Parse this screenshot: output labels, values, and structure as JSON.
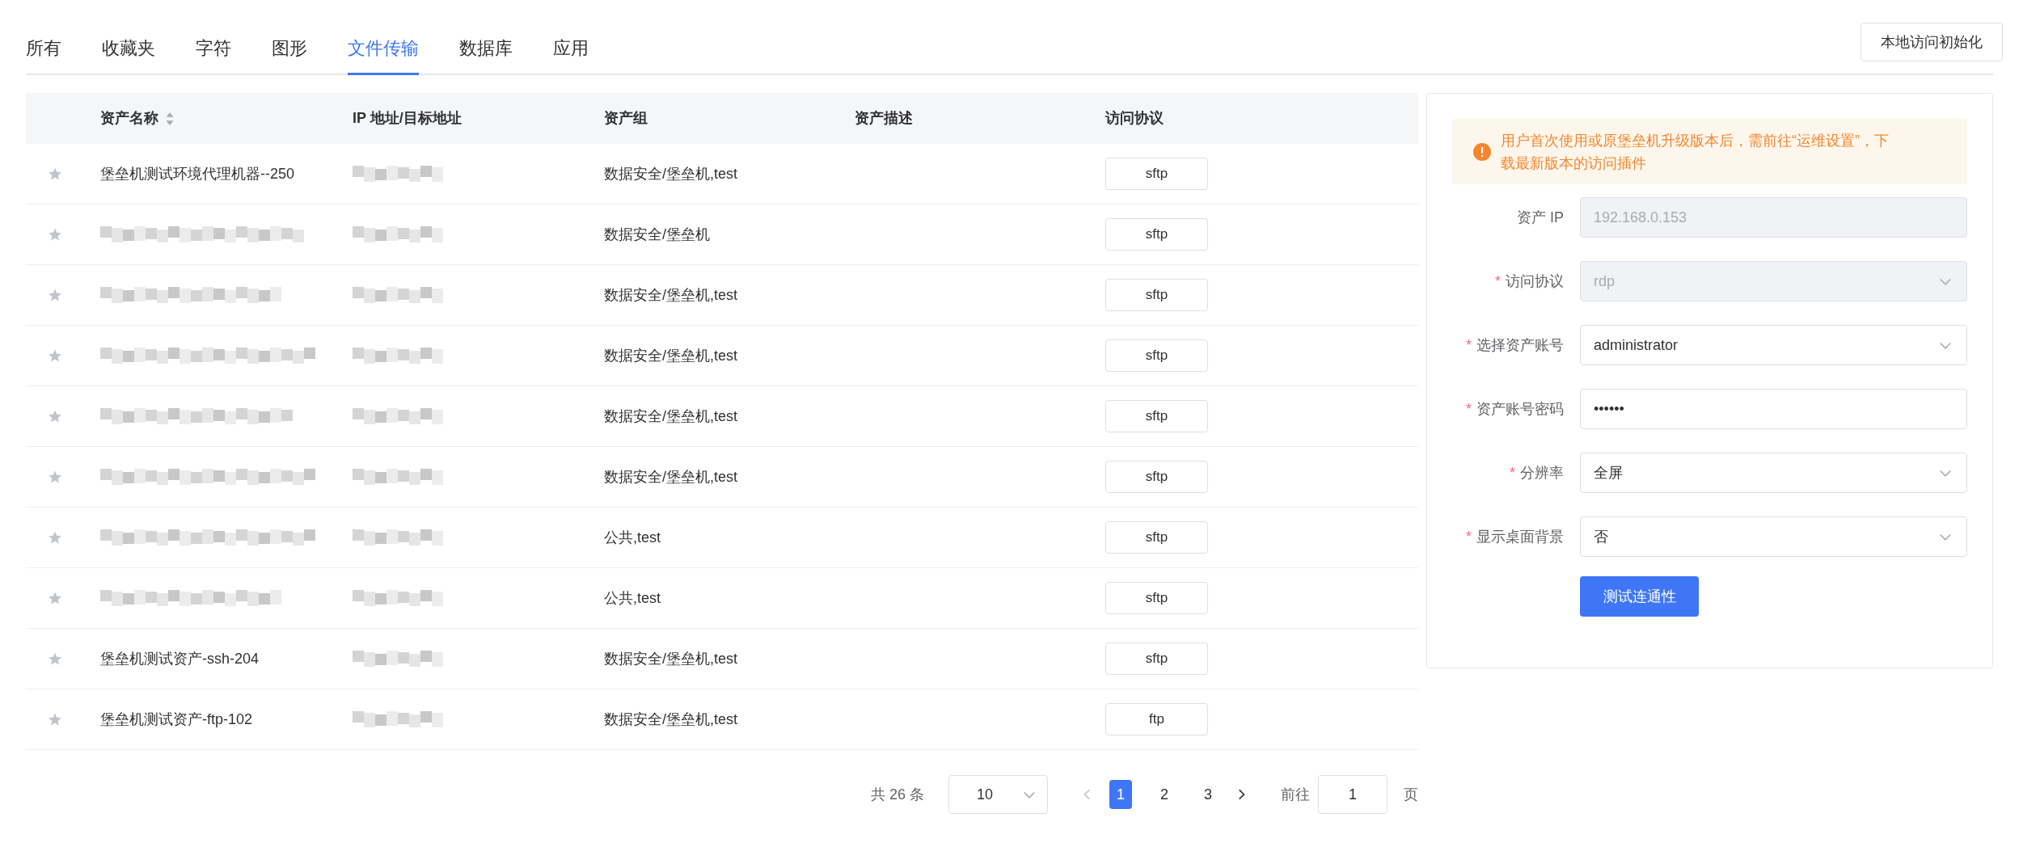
{
  "tabs": [
    {
      "label": "所有",
      "selected": false
    },
    {
      "label": "收藏夹",
      "selected": false
    },
    {
      "label": "字符",
      "selected": false
    },
    {
      "label": "图形",
      "selected": false
    },
    {
      "label": "文件传输",
      "selected": true
    },
    {
      "label": "数据库",
      "selected": false
    },
    {
      "label": "应用",
      "selected": false
    }
  ],
  "init_button": "本地访问初始化",
  "table": {
    "columns": [
      "资产名称",
      "IP 地址/目标地址",
      "资产组",
      "资产描述",
      "访问协议"
    ],
    "rows": [
      {
        "starred": false,
        "name": "堡垒机测试环境代理机器--250",
        "name_redacted": false,
        "ip_redacted": true,
        "group": "数据安全/堡垒机,test",
        "protocol": "sftp"
      },
      {
        "starred": false,
        "name_redacted": true,
        "ip_redacted": true,
        "group": "数据安全/堡垒机",
        "protocol": "sftp"
      },
      {
        "starred": false,
        "name_redacted": true,
        "ip_redacted": true,
        "group": "数据安全/堡垒机,test",
        "protocol": "sftp"
      },
      {
        "starred": false,
        "name_redacted": true,
        "ip_redacted": true,
        "group": "数据安全/堡垒机,test",
        "protocol": "sftp"
      },
      {
        "starred": false,
        "name_redacted": true,
        "ip_redacted": true,
        "group": "数据安全/堡垒机,test",
        "protocol": "sftp"
      },
      {
        "starred": false,
        "name_redacted": true,
        "ip_redacted": true,
        "group": "数据安全/堡垒机,test",
        "protocol": "sftp"
      },
      {
        "starred": false,
        "name_redacted": true,
        "ip_redacted": true,
        "group": "公共,test",
        "protocol": "sftp"
      },
      {
        "starred": false,
        "name_redacted": true,
        "ip_redacted": true,
        "group": "公共,test",
        "protocol": "sftp"
      },
      {
        "starred": false,
        "name": "堡垒机测试资产-ssh-204",
        "name_redacted": false,
        "ip_redacted": true,
        "group": "数据安全/堡垒机,test",
        "protocol": "sftp"
      },
      {
        "starred": false,
        "name": "堡垒机测试资产-ftp-102",
        "name_redacted": false,
        "ip_redacted": true,
        "group": "数据安全/堡垒机,test",
        "protocol": "ftp"
      }
    ]
  },
  "pagination": {
    "total": "共 26 条",
    "page_size": "10",
    "pages": [
      {
        "label": "1",
        "selected": true
      },
      {
        "label": "2",
        "selected": false
      },
      {
        "label": "3",
        "selected": false
      }
    ],
    "goto_label": "前往",
    "goto_value": "1",
    "goto_suffix": "页"
  },
  "panel": {
    "alert": "用户首次使用或原堡垒机升级版本后，需前往“运维设置”，下载最新版本的访问插件",
    "fields": [
      {
        "label": "资产 IP",
        "kind": "input",
        "value": "192.168.0.153",
        "disabled": true
      },
      {
        "label": "访问协议",
        "required_mark": "*",
        "kind": "select",
        "value": "rdp",
        "disabled": true
      },
      {
        "label": "选择资产账号",
        "required_mark": "*",
        "kind": "select",
        "value": "administrator",
        "disabled": false
      },
      {
        "label": "资产账号密码",
        "required_mark": "*",
        "kind": "input",
        "value": "••••••",
        "disabled": false
      },
      {
        "label": "分辨率",
        "required_mark": "*",
        "kind": "select",
        "value": "全屏",
        "disabled": false
      },
      {
        "label": "显示桌面背景",
        "required_mark": "*",
        "kind": "select",
        "value": "否",
        "disabled": false
      }
    ],
    "test_button": "测试连通性"
  }
}
